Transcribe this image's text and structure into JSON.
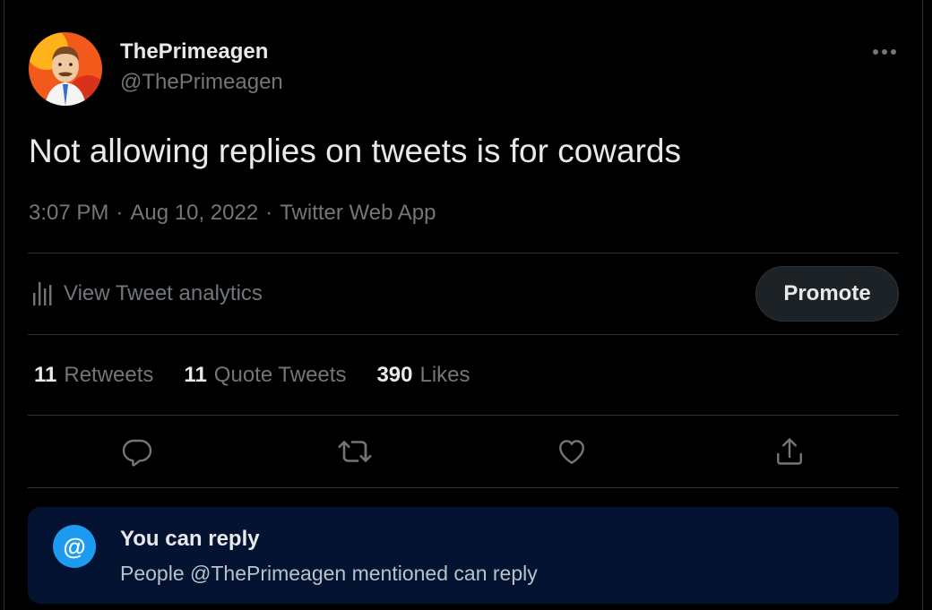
{
  "tweet": {
    "author": {
      "display_name": "ThePrimeagen",
      "handle": "@ThePrimeagen",
      "avatar_icon": "avatar-photo"
    },
    "more_icon": "more-dots-icon",
    "text": "Not allowing replies on tweets is for cowards",
    "time": "3:07 PM",
    "date": "Aug 10, 2022",
    "source": "Twitter Web App",
    "separator": "·"
  },
  "analytics": {
    "icon": "analytics-bars-icon",
    "label": "View Tweet analytics",
    "promote_label": "Promote"
  },
  "stats": [
    {
      "count": "11",
      "label": "Retweets"
    },
    {
      "count": "11",
      "label": "Quote Tweets"
    },
    {
      "count": "390",
      "label": "Likes"
    }
  ],
  "actions": [
    {
      "name": "reply",
      "icon": "reply-bubble-icon"
    },
    {
      "name": "retweet",
      "icon": "retweet-icon"
    },
    {
      "name": "like",
      "icon": "heart-icon"
    },
    {
      "name": "share",
      "icon": "share-upload-icon"
    }
  ],
  "reply_notice": {
    "icon": "at-sign-icon",
    "icon_glyph": "@",
    "title": "You can reply",
    "subtitle": "People @ThePrimeagen mentioned can reply"
  },
  "colors": {
    "background": "#000000",
    "text_primary": "#e7e9ea",
    "text_secondary": "#71767b",
    "divider": "#2f3336",
    "accent": "#1d9bf0",
    "reply_box_bg": "#041331",
    "promote_bg": "#1d2226"
  }
}
